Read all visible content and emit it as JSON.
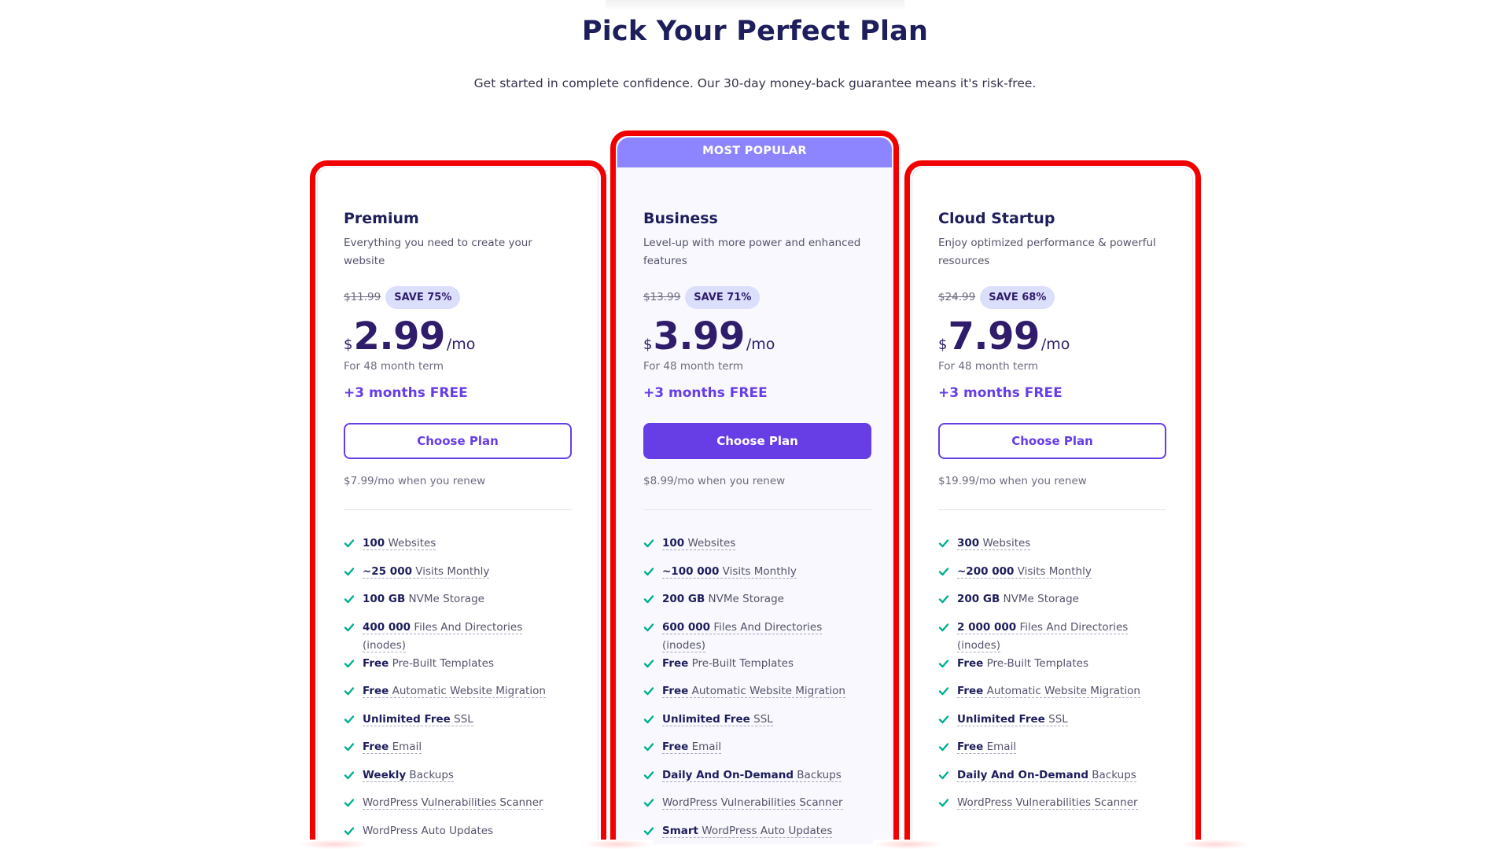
{
  "header": {
    "title": "Pick Your Perfect Plan",
    "subtitle": "Get started in complete confidence. Our 30-day money-back guarantee means it's risk-free."
  },
  "colors": {
    "accent": "#673de6",
    "banner": "#8c85ff",
    "highlight_frame": "#f20000",
    "check": "#00b090",
    "heading": "#1d1e5b"
  },
  "plans": [
    {
      "name": "Premium",
      "description": "Everything you need to create your website",
      "old_price": "$11.99",
      "save_badge": "SAVE 75%",
      "currency": "$",
      "price": "2.99",
      "period": "/mo",
      "term": "For 48 month term",
      "bonus": "+3 months FREE",
      "button": "Choose Plan",
      "renew": "$7.99/mo when you renew",
      "features": [
        {
          "bold": "100",
          "text": " Websites",
          "underlined": true
        },
        {
          "bold": "~25 000",
          "text": " Visits Monthly",
          "underlined": true
        },
        {
          "bold": "100 GB",
          "text": " NVMe Storage",
          "underlined": false
        },
        {
          "bold": "400 000",
          "text": " Files And Directories (inodes)",
          "underlined": true
        },
        {
          "bold": "Free",
          "text": " Pre-Built Templates",
          "underlined": false
        },
        {
          "bold": "Free",
          "text": " Automatic Website Migration",
          "underlined": true
        },
        {
          "bold": "Unlimited Free",
          "text": " SSL",
          "underlined": true
        },
        {
          "bold": "Free",
          "text": " Email",
          "underlined": true
        },
        {
          "bold": "Weekly",
          "text": " Backups",
          "underlined": true
        },
        {
          "bold": "",
          "text": "WordPress Vulnerabilities Scanner",
          "underlined": true
        },
        {
          "bold": "",
          "text": "WordPress Auto Updates",
          "underlined": false
        }
      ]
    },
    {
      "name": "Business",
      "banner": "MOST POPULAR",
      "description": "Level-up with more power and enhanced features",
      "old_price": "$13.99",
      "save_badge": "SAVE 71%",
      "currency": "$",
      "price": "3.99",
      "period": "/mo",
      "term": "For 48 month term",
      "bonus": "+3 months FREE",
      "button": "Choose Plan",
      "renew": "$8.99/mo when you renew",
      "features": [
        {
          "bold": "100",
          "text": " Websites",
          "underlined": true
        },
        {
          "bold": "~100 000",
          "text": " Visits Monthly",
          "underlined": true
        },
        {
          "bold": "200 GB",
          "text": " NVMe Storage",
          "underlined": false
        },
        {
          "bold": "600 000",
          "text": " Files And Directories (inodes)",
          "underlined": true
        },
        {
          "bold": "Free",
          "text": " Pre-Built Templates",
          "underlined": false
        },
        {
          "bold": "Free",
          "text": " Automatic Website Migration",
          "underlined": true
        },
        {
          "bold": "Unlimited Free",
          "text": " SSL",
          "underlined": true
        },
        {
          "bold": "Free",
          "text": " Email",
          "underlined": true
        },
        {
          "bold": "Daily And On-Demand",
          "text": " Backups",
          "underlined": true
        },
        {
          "bold": "",
          "text": "WordPress Vulnerabilities Scanner",
          "underlined": true
        },
        {
          "bold": "Smart",
          "text": " WordPress Auto Updates",
          "underlined": true
        }
      ]
    },
    {
      "name": "Cloud Startup",
      "description": "Enjoy optimized performance & powerful resources",
      "old_price": "$24.99",
      "save_badge": "SAVE 68%",
      "currency": "$",
      "price": "7.99",
      "period": "/mo",
      "term": "For 48 month term",
      "bonus": "+3 months FREE",
      "button": "Choose Plan",
      "renew": "$19.99/mo when you renew",
      "features": [
        {
          "bold": "300",
          "text": " Websites",
          "underlined": true
        },
        {
          "bold": "~200 000",
          "text": " Visits Monthly",
          "underlined": true
        },
        {
          "bold": "200 GB",
          "text": " NVMe Storage",
          "underlined": false
        },
        {
          "bold": "2 000 000",
          "text": " Files And Directories (inodes)",
          "underlined": true
        },
        {
          "bold": "Free",
          "text": " Pre-Built Templates",
          "underlined": false
        },
        {
          "bold": "Free",
          "text": " Automatic Website Migration",
          "underlined": true
        },
        {
          "bold": "Unlimited Free",
          "text": " SSL",
          "underlined": true
        },
        {
          "bold": "Free",
          "text": " Email",
          "underlined": true
        },
        {
          "bold": "Daily And On-Demand",
          "text": " Backups",
          "underlined": true
        },
        {
          "bold": "",
          "text": "WordPress Vulnerabilities Scanner",
          "underlined": true
        }
      ]
    }
  ]
}
